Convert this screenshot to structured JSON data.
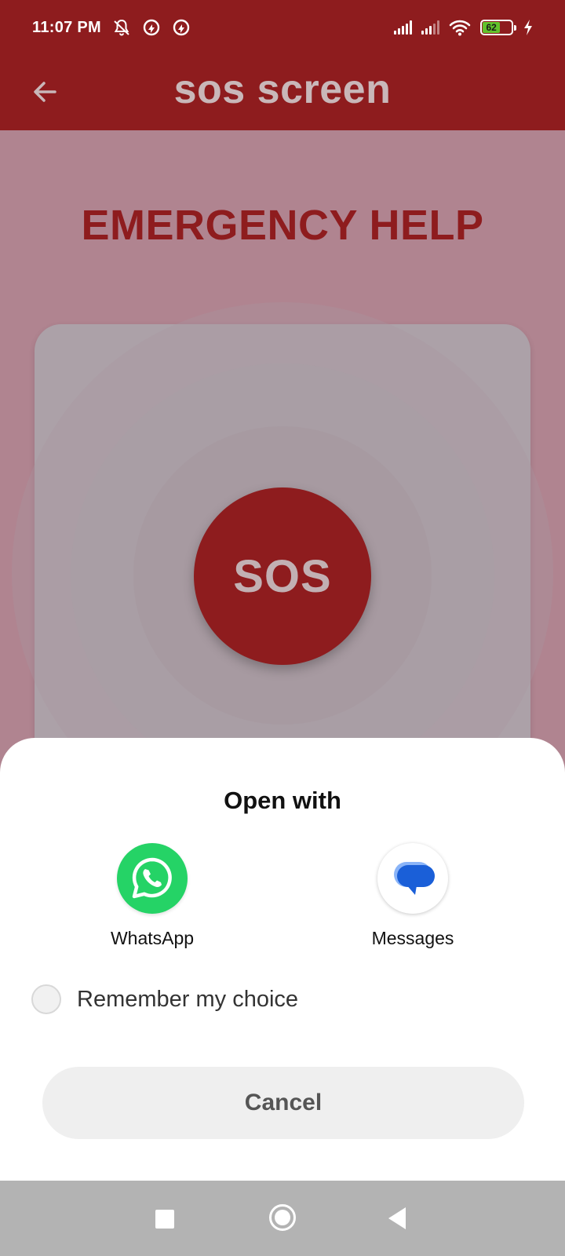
{
  "status_bar": {
    "time": "11:07 PM",
    "battery_level": "62",
    "icons": [
      "mute-icon",
      "data-saver-icon",
      "data-saver-icon",
      "signal-icon",
      "signal-icon",
      "wifi-icon",
      "battery-icon",
      "charging-icon"
    ]
  },
  "app_bar": {
    "title": "sos screen",
    "back_icon": "arrow-left-icon"
  },
  "main": {
    "headline": "EMERGENCY HELP",
    "sos_label": "SOS"
  },
  "sheet": {
    "title": "Open with",
    "apps": [
      {
        "label": "WhatsApp",
        "icon": "whatsapp-icon"
      },
      {
        "label": "Messages",
        "icon": "messages-icon"
      }
    ],
    "remember_label": "Remember my choice",
    "remember_checked": false,
    "cancel_label": "Cancel"
  },
  "nav_bar": {
    "icons": [
      "recent-apps-icon",
      "home-icon",
      "back-icon"
    ]
  },
  "colors": {
    "primary": "#8e1c1e",
    "scrim_background": "#b08490",
    "whatsapp_green": "#25d366",
    "messages_blue": "#1a5fd8"
  }
}
